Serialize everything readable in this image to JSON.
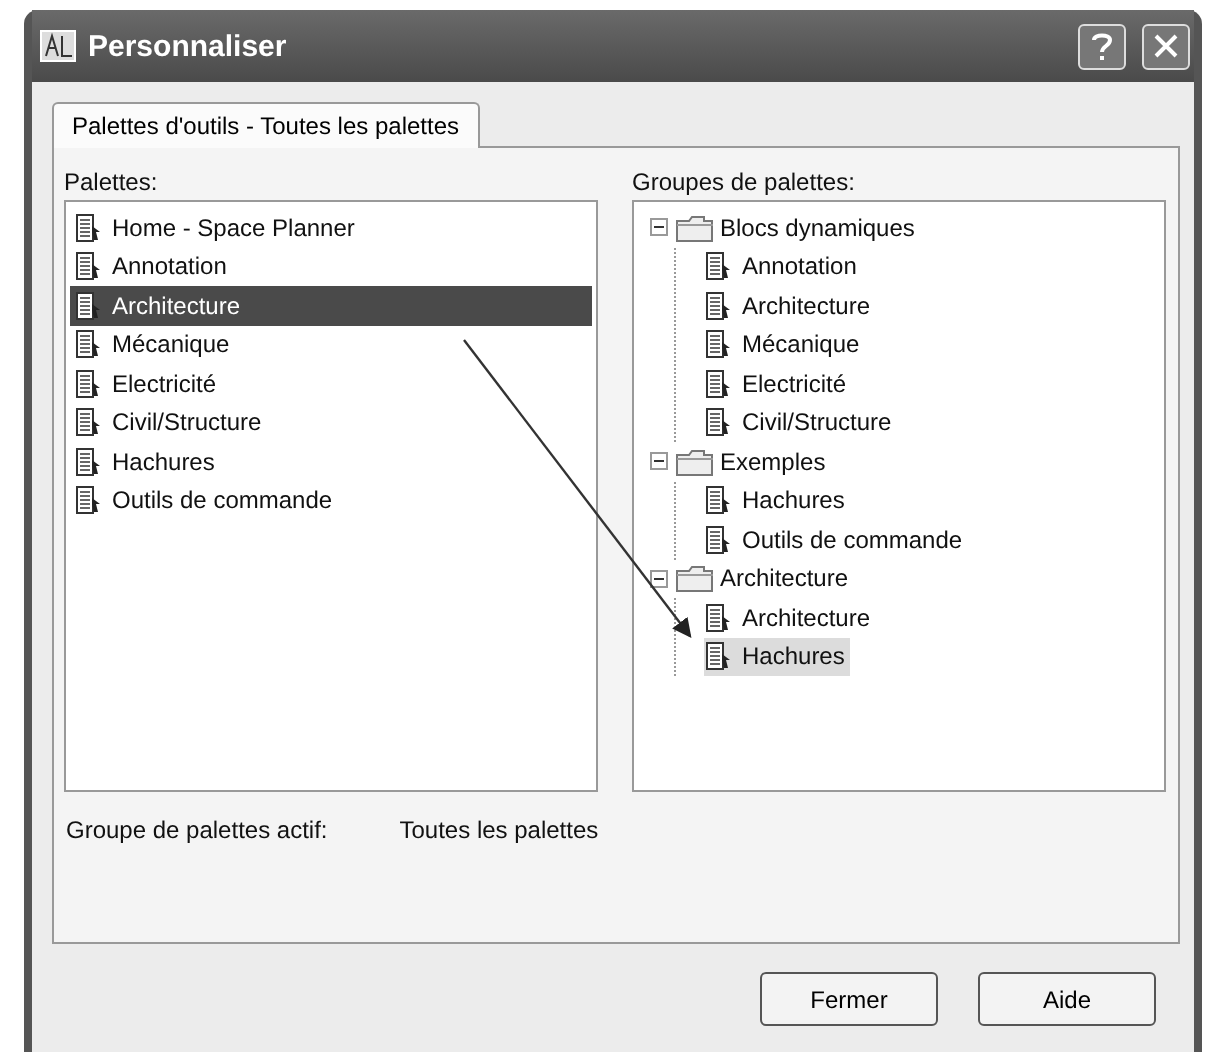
{
  "window": {
    "title": "Personnaliser"
  },
  "tabs": [
    {
      "label": "Palettes d'outils - Toutes les palettes",
      "selected": true
    }
  ],
  "palettes": {
    "label": "Palettes:",
    "items": [
      {
        "label": "Home - Space Planner",
        "selected": false
      },
      {
        "label": "Annotation",
        "selected": false
      },
      {
        "label": "Architecture",
        "selected": true
      },
      {
        "label": "Mécanique",
        "selected": false
      },
      {
        "label": "Electricité",
        "selected": false
      },
      {
        "label": "Civil/Structure",
        "selected": false
      },
      {
        "label": "Hachures",
        "selected": false
      },
      {
        "label": "Outils de commande",
        "selected": false
      }
    ]
  },
  "palette_groups": {
    "label": "Groupes de palettes:",
    "groups": [
      {
        "label": "Blocs dynamiques",
        "expanded": true,
        "children": [
          {
            "label": "Annotation",
            "selected": false
          },
          {
            "label": "Architecture",
            "selected": false
          },
          {
            "label": "Mécanique",
            "selected": false
          },
          {
            "label": "Electricité",
            "selected": false
          },
          {
            "label": "Civil/Structure",
            "selected": false
          }
        ]
      },
      {
        "label": "Exemples",
        "expanded": true,
        "children": [
          {
            "label": "Hachures",
            "selected": false
          },
          {
            "label": "Outils de commande",
            "selected": false
          }
        ]
      },
      {
        "label": "Architecture",
        "expanded": true,
        "children": [
          {
            "label": "Architecture",
            "selected": false
          },
          {
            "label": "Hachures",
            "selected": true
          }
        ]
      }
    ]
  },
  "active_group": {
    "label": "Groupe de palettes actif:",
    "value": "Toutes les palettes"
  },
  "buttons": [
    "Fermer",
    "Aide"
  ]
}
